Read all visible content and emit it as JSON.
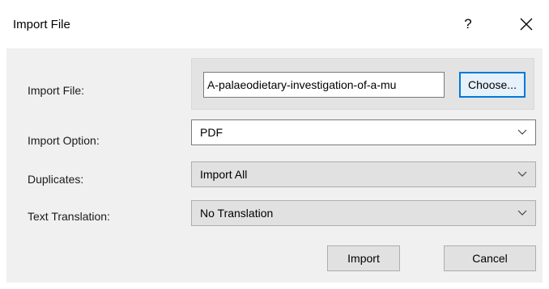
{
  "dialog": {
    "title": "Import File",
    "help_label": "?",
    "close_icon": "close-icon"
  },
  "import_file": {
    "label": "Import File:",
    "value": "A-palaeodietary-investigation-of-a-mu",
    "choose_label": "Choose..."
  },
  "import_option": {
    "label": "Import Option:",
    "value": "PDF",
    "icon": "chevron-down-icon"
  },
  "duplicates": {
    "label": "Duplicates:",
    "value": "Import All",
    "icon": "chevron-down-icon"
  },
  "text_translation": {
    "label": "Text Translation:",
    "value": "No Translation",
    "icon": "chevron-down-icon"
  },
  "actions": {
    "import_label": "Import",
    "cancel_label": "Cancel"
  },
  "colors": {
    "panel": "#f0f0f0",
    "focus_accent": "#0078d7",
    "button_face": "#e1e1e1"
  }
}
